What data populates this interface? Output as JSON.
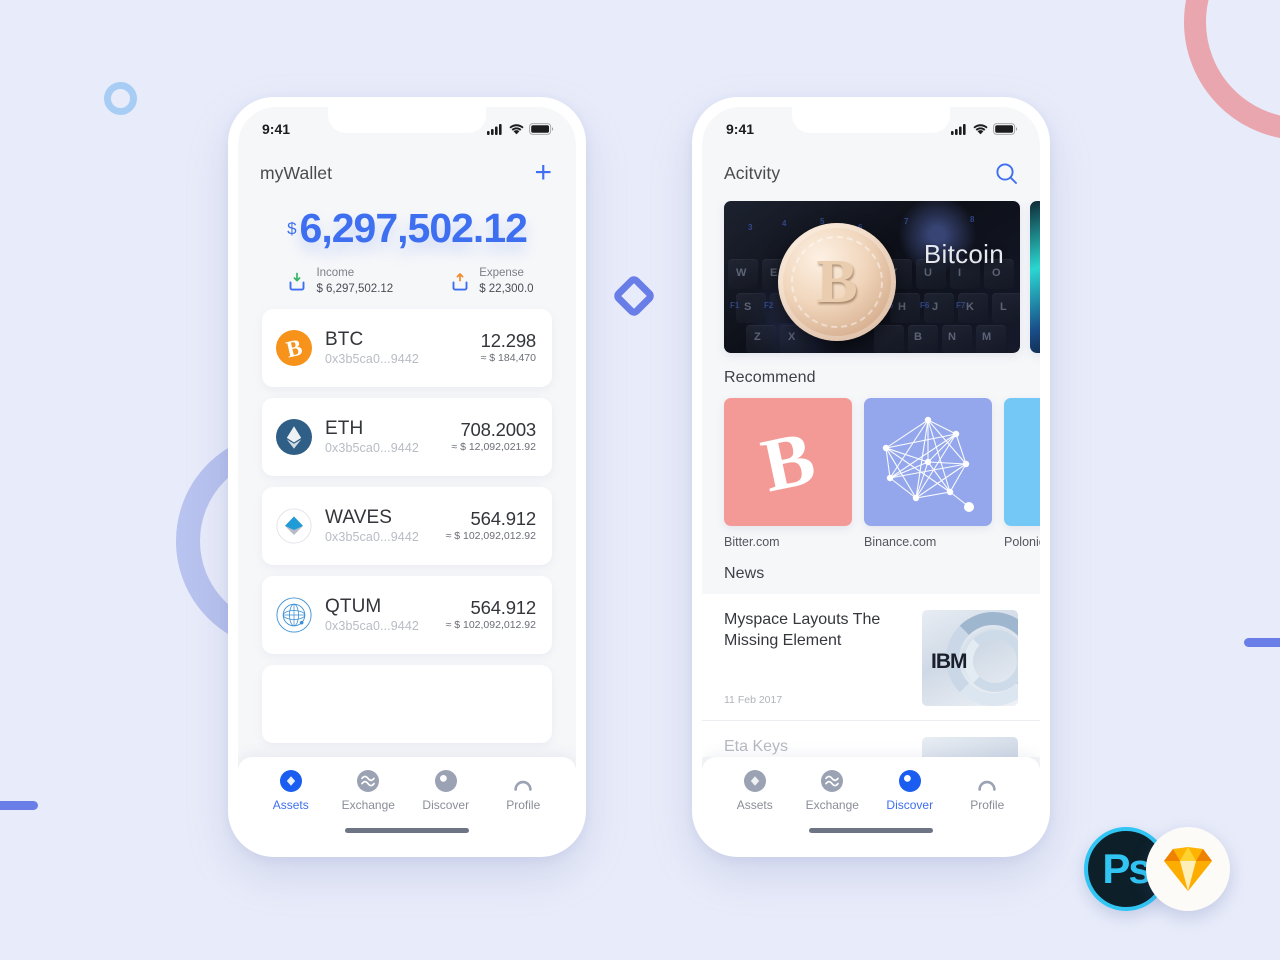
{
  "theme": {
    "background": "#e8ecfa",
    "accent": "#3d6ff0",
    "muted_text": "#8a8e98",
    "ring_pink": "#e9a6ae",
    "ring_lavender": "#b9c3ef",
    "ring_blue": "#a8cdf5",
    "diamond_blue": "#6a7ee8"
  },
  "decorations": {
    "ring_pink": "pink-circle-outline",
    "ring_lavender": "lavender-circle-outline",
    "ring_blue": "small-blue-circle-outline",
    "diamond": "blue-diamond-outline",
    "bar_left": "blue-pill-bar",
    "bar_right": "blue-pill-bar"
  },
  "badges": {
    "photoshop": {
      "label": "Ps",
      "icon": "photoshop-icon"
    },
    "sketch": {
      "label": "",
      "icon": "sketch-gem-icon"
    }
  },
  "wallet_screen": {
    "status": {
      "time": "9:41",
      "signal": "signal-icon",
      "wifi": "wifi-icon",
      "battery": "battery-icon"
    },
    "header": {
      "title": "myWallet",
      "add_label": "+"
    },
    "balance": {
      "currency": "$",
      "amount": "6,297,502.12",
      "income": {
        "label": "Income",
        "value": "$ 6,297,502.12",
        "icon": "download-tray-icon"
      },
      "expense": {
        "label": "Expense",
        "value": "$ 22,300.0",
        "icon": "upload-tray-icon"
      }
    },
    "assets": [
      {
        "symbol": "BTC",
        "address": "0x3b5ca0...9442",
        "quantity": "12.298",
        "fiat": "≈ $ 184,470",
        "icon": "bitcoin-icon"
      },
      {
        "symbol": "ETH",
        "address": "0x3b5ca0...9442",
        "quantity": "708.2003",
        "fiat": "≈ $ 12,092,021.92",
        "icon": "ethereum-icon"
      },
      {
        "symbol": "WAVES",
        "address": "0x3b5ca0...9442",
        "quantity": "564.912",
        "fiat": "≈ $ 102,092,012.92",
        "icon": "waves-icon"
      },
      {
        "symbol": "QTUM",
        "address": "0x3b5ca0...9442",
        "quantity": "564.912",
        "fiat": "≈ $ 102,092,012.92",
        "icon": "qtum-icon"
      }
    ],
    "tabs": [
      {
        "label": "Assets",
        "icon": "diamond-icon",
        "active": true
      },
      {
        "label": "Exchange",
        "icon": "exchange-icon",
        "active": false
      },
      {
        "label": "Discover",
        "icon": "compass-icon",
        "active": false
      },
      {
        "label": "Profile",
        "icon": "person-icon",
        "active": false
      }
    ]
  },
  "discover_screen": {
    "status": {
      "time": "9:41",
      "signal": "signal-icon",
      "wifi": "wifi-icon",
      "battery": "battery-icon"
    },
    "header": {
      "title": "Acitvity",
      "search_icon": "search-icon"
    },
    "banner": {
      "caption": "Bitcoin",
      "image": "bitcoin-coin-on-keyboard-photo"
    },
    "recommend": {
      "title": "Recommend",
      "items": [
        {
          "label": "Bitter.com",
          "color": "#f49a96",
          "icon": "bitcoin-glyph-icon"
        },
        {
          "label": "Binance.com",
          "color": "#94a7ec",
          "icon": "network-graph-icon"
        },
        {
          "label": "Poloniex",
          "color": "#74c8f5",
          "icon": "poloniex-icon"
        }
      ]
    },
    "news": {
      "title": "News",
      "items": [
        {
          "headline": "Myspace Layouts The Missing Element",
          "date": "11 Feb 2017",
          "thumb": "ibm-server-photo"
        },
        {
          "headline": "Eta Keys",
          "date": "",
          "thumb": "person-photo"
        }
      ]
    },
    "tabs": [
      {
        "label": "Assets",
        "icon": "diamond-icon",
        "active": false
      },
      {
        "label": "Exchange",
        "icon": "exchange-icon",
        "active": false
      },
      {
        "label": "Discover",
        "icon": "compass-icon",
        "active": true
      },
      {
        "label": "Profile",
        "icon": "person-icon",
        "active": false
      }
    ]
  }
}
